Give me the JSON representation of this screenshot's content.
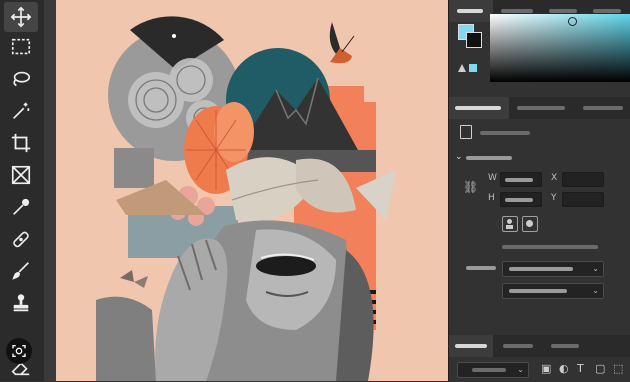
{
  "toolbar": {
    "tools": [
      {
        "name": "move-tool"
      },
      {
        "name": "marquee-tool"
      },
      {
        "name": "lasso-tool"
      },
      {
        "name": "magic-wand-tool"
      },
      {
        "name": "crop-tool"
      },
      {
        "name": "frame-tool"
      },
      {
        "name": "eyedropper-tool"
      },
      {
        "name": "healing-brush-tool"
      },
      {
        "name": "brush-tool"
      },
      {
        "name": "clone-stamp-tool"
      },
      {
        "name": "eraser-tool"
      }
    ],
    "active_tool": "move-tool"
  },
  "colors": {
    "foreground": "#7fd9f2",
    "background": "#111111",
    "picker_hue": "#5fd5ea",
    "canvas_bg": "#f1c6ae",
    "accent_orange": "#f2805a",
    "accent_teal": "#1f5c66"
  },
  "properties": {
    "width_label": "W",
    "height_label": "H",
    "x_label": "X",
    "y_label": "Y"
  },
  "bottom_panel": {
    "icons": [
      "image-icon",
      "circle-half-icon",
      "type-icon",
      "shape-icon",
      "artboard-icon"
    ]
  }
}
